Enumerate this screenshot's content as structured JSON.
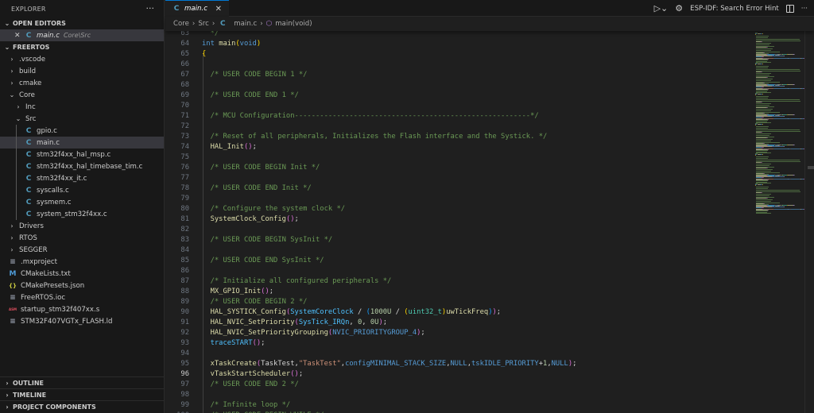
{
  "sidebar": {
    "title": "EXPLORER",
    "more": "···",
    "open_editors": {
      "label": "OPEN EDITORS",
      "item": {
        "name": "main.c",
        "path": "Core\\Src",
        "icon": "c-file-icon"
      }
    },
    "project": {
      "label": "FREERTOS",
      "items": [
        {
          "name": ".vscode",
          "depth": 0,
          "kind": "folder"
        },
        {
          "name": "build",
          "depth": 0,
          "kind": "folder"
        },
        {
          "name": "cmake",
          "depth": 0,
          "kind": "folder"
        },
        {
          "name": "Core",
          "depth": 0,
          "kind": "folder-open"
        },
        {
          "name": "Inc",
          "depth": 1,
          "kind": "folder"
        },
        {
          "name": "Src",
          "depth": 1,
          "kind": "folder-open"
        },
        {
          "name": "gpio.c",
          "depth": 2,
          "kind": "c"
        },
        {
          "name": "main.c",
          "depth": 2,
          "kind": "c",
          "selected": true
        },
        {
          "name": "stm32f4xx_hal_msp.c",
          "depth": 2,
          "kind": "c"
        },
        {
          "name": "stm32f4xx_hal_timebase_tim.c",
          "depth": 2,
          "kind": "c"
        },
        {
          "name": "stm32f4xx_it.c",
          "depth": 2,
          "kind": "c"
        },
        {
          "name": "syscalls.c",
          "depth": 2,
          "kind": "c"
        },
        {
          "name": "sysmem.c",
          "depth": 2,
          "kind": "c"
        },
        {
          "name": "system_stm32f4xx.c",
          "depth": 2,
          "kind": "c"
        },
        {
          "name": "Drivers",
          "depth": 0,
          "kind": "folder"
        },
        {
          "name": "RTOS",
          "depth": 0,
          "kind": "folder"
        },
        {
          "name": "SEGGER",
          "depth": 0,
          "kind": "folder"
        },
        {
          "name": ".mxproject",
          "depth": 0,
          "kind": "text"
        },
        {
          "name": "CMakeLists.txt",
          "depth": 0,
          "kind": "cmake"
        },
        {
          "name": "CMakePresets.json",
          "depth": 0,
          "kind": "json"
        },
        {
          "name": "FreeRTOS.ioc",
          "depth": 0,
          "kind": "text"
        },
        {
          "name": "startup_stm32f407xx.s",
          "depth": 0,
          "kind": "asm"
        },
        {
          "name": "STM32F407VGTx_FLASH.ld",
          "depth": 0,
          "kind": "text"
        }
      ]
    },
    "bottom_sections": [
      "OUTLINE",
      "TIMELINE",
      "PROJECT COMPONENTS"
    ]
  },
  "tab": {
    "label": "main.c",
    "close": "✕"
  },
  "actions": {
    "hint": "ESP-IDF: Search Error Hint",
    "icons": [
      "run-debug-icon",
      "gear-icon",
      "split-editor-icon",
      "more-icon"
    ]
  },
  "breadcrumb": [
    "Core",
    "Src",
    "main.c",
    "main(void)"
  ],
  "editor": {
    "current_line": 96,
    "first_line": 63,
    "lines": [
      [
        [
          "cm",
          "  */"
        ]
      ],
      [
        [
          "kw",
          "int"
        ],
        [
          "p",
          " "
        ],
        [
          "fn",
          "main"
        ],
        [
          "b1",
          "("
        ],
        [
          "kw",
          "void"
        ],
        [
          "b1",
          ")"
        ]
      ],
      [
        [
          "b1",
          "{"
        ]
      ],
      [],
      [
        [
          "p",
          "  "
        ],
        [
          "cm",
          "/* USER CODE BEGIN 1 */"
        ]
      ],
      [],
      [
        [
          "p",
          "  "
        ],
        [
          "cm",
          "/* USER CODE END 1 */"
        ]
      ],
      [],
      [
        [
          "p",
          "  "
        ],
        [
          "cm",
          "/* MCU Configuration--------------------------------------------------------*/"
        ]
      ],
      [],
      [
        [
          "p",
          "  "
        ],
        [
          "cm",
          "/* Reset of all peripherals, Initializes the Flash interface and the Systick. */"
        ]
      ],
      [
        [
          "p",
          "  "
        ],
        [
          "fn",
          "HAL_Init"
        ],
        [
          "b2",
          "()"
        ],
        [
          "p",
          ";"
        ]
      ],
      [],
      [
        [
          "p",
          "  "
        ],
        [
          "cm",
          "/* USER CODE BEGIN Init */"
        ]
      ],
      [],
      [
        [
          "p",
          "  "
        ],
        [
          "cm",
          "/* USER CODE END Init */"
        ]
      ],
      [],
      [
        [
          "p",
          "  "
        ],
        [
          "cm",
          "/* Configure the system clock */"
        ]
      ],
      [
        [
          "p",
          "  "
        ],
        [
          "fn",
          "SystemClock_Config"
        ],
        [
          "b2",
          "()"
        ],
        [
          "p",
          ";"
        ]
      ],
      [],
      [
        [
          "p",
          "  "
        ],
        [
          "cm",
          "/* USER CODE BEGIN SysInit */"
        ]
      ],
      [],
      [
        [
          "p",
          "  "
        ],
        [
          "cm",
          "/* USER CODE END SysInit */"
        ]
      ],
      [],
      [
        [
          "p",
          "  "
        ],
        [
          "cm",
          "/* Initialize all configured peripherals */"
        ]
      ],
      [
        [
          "p",
          "  "
        ],
        [
          "fn",
          "MX_GPIO_Init"
        ],
        [
          "b2",
          "()"
        ],
        [
          "p",
          ";"
        ]
      ],
      [
        [
          "p",
          "  "
        ],
        [
          "cm",
          "/* USER CODE BEGIN 2 */"
        ]
      ],
      [
        [
          "p",
          "  "
        ],
        [
          "fn",
          "HAL_SYSTICK_Config"
        ],
        [
          "b2",
          "("
        ],
        [
          "mac",
          "SystemCoreClock"
        ],
        [
          "p",
          " / "
        ],
        [
          "b3",
          "("
        ],
        [
          "num",
          "1000U"
        ],
        [
          "p",
          " / "
        ],
        [
          "b1",
          "("
        ],
        [
          "ty",
          "uint32_t"
        ],
        [
          "b1",
          ")"
        ],
        [
          "fn",
          "uwTickFreq"
        ],
        [
          "b3",
          ")"
        ],
        [
          "b2",
          ")"
        ],
        [
          "p",
          ";"
        ]
      ],
      [
        [
          "p",
          "  "
        ],
        [
          "fn",
          "HAL_NVIC_SetPriority"
        ],
        [
          "b2",
          "("
        ],
        [
          "mac",
          "SysTick_IRQn"
        ],
        [
          "p",
          ", "
        ],
        [
          "num",
          "0"
        ],
        [
          "p",
          ", "
        ],
        [
          "num",
          "0U"
        ],
        [
          "b2",
          ")"
        ],
        [
          "p",
          ";"
        ]
      ],
      [
        [
          "p",
          "  "
        ],
        [
          "fn",
          "HAL_NVIC_SetPriorityGrouping"
        ],
        [
          "b2",
          "("
        ],
        [
          "cst",
          "NVIC_PRIORITYGROUP_4"
        ],
        [
          "b2",
          ")"
        ],
        [
          "p",
          ";"
        ]
      ],
      [
        [
          "p",
          "  "
        ],
        [
          "mac",
          "traceSTART"
        ],
        [
          "b2",
          "()"
        ],
        [
          "p",
          ";"
        ]
      ],
      [],
      [
        [
          "p",
          "  "
        ],
        [
          "fn",
          "xTaskCreate"
        ],
        [
          "b2",
          "("
        ],
        [
          "p",
          "TaskTest,"
        ],
        [
          "str",
          "\"TaskTest\""
        ],
        [
          "p",
          ","
        ],
        [
          "cst",
          "configMINIMAL_STACK_SIZE"
        ],
        [
          "p",
          ","
        ],
        [
          "cst",
          "NULL"
        ],
        [
          "p",
          ","
        ],
        [
          "cst",
          "tskIDLE_PRIORITY"
        ],
        [
          "p",
          "+"
        ],
        [
          "num",
          "1"
        ],
        [
          "p",
          ","
        ],
        [
          "cst",
          "NULL"
        ],
        [
          "b2",
          ")"
        ],
        [
          "p",
          ";"
        ]
      ],
      [
        [
          "p",
          "  "
        ],
        [
          "fn",
          "vTaskStartScheduler"
        ],
        [
          "b2",
          "()"
        ],
        [
          "p",
          ";"
        ]
      ],
      [
        [
          "p",
          "  "
        ],
        [
          "cm",
          "/* USER CODE END 2 */"
        ]
      ],
      [],
      [
        [
          "p",
          "  "
        ],
        [
          "cm",
          "/* Infinite loop */"
        ]
      ],
      [
        [
          "p",
          "  "
        ],
        [
          "cm",
          "/* USER CODE BEGIN WHILE */"
        ]
      ]
    ]
  },
  "colors": {
    "accent": "#0078d4",
    "c_icon": "#519aba",
    "cmake_icon": "#4e9ad6",
    "json_icon": "#cbcb41",
    "asm_icon": "#e04f5f"
  }
}
